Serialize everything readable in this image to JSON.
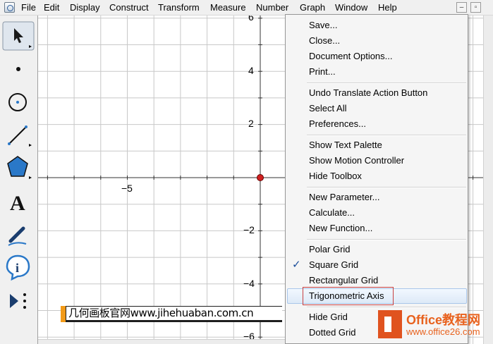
{
  "menubar": {
    "items": [
      "File",
      "Edit",
      "Display",
      "Construct",
      "Transform",
      "Measure",
      "Number",
      "Graph",
      "Window",
      "Help"
    ],
    "minimize": "–",
    "restore": "▫"
  },
  "toolbox": {
    "tools": [
      "arrow-tool",
      "point-tool",
      "compass-tool",
      "straightedge-tool",
      "polygon-tool",
      "text-tool",
      "marker-tool",
      "information-tool",
      "custom-tool"
    ]
  },
  "graph": {
    "x_labels": [
      "−5"
    ],
    "y_labels": [
      "6",
      "4",
      "2",
      "−2",
      "−4",
      "−6"
    ],
    "origin_point_color": "#d02020",
    "grid": true
  },
  "watermark": {
    "text": "几何画板官网www.jihehuaban.com.cn"
  },
  "dropdown": {
    "items": [
      "Save...",
      "Close...",
      "Document Options...",
      "Print...",
      "Undo Translate Action Button",
      "Select All",
      "Preferences...",
      "Show Text Palette",
      "Show Motion Controller",
      "Hide Toolbox",
      "New Parameter...",
      "Calculate...",
      "New Function...",
      "Polar Grid",
      "Square Grid",
      "Rectangular Grid",
      "Trigonometric Axis",
      "Hide Grid",
      "Dotted Grid"
    ],
    "checked_item": "Square Grid",
    "highlighted_item": "Trigonometric Axis",
    "checkmark": "✓"
  },
  "office_logo": {
    "name": "Office教程网",
    "url": "www.office26.com"
  },
  "colors": {
    "accent_orange": "#e8621e",
    "highlight_border": "#c84040",
    "toolbox_blue": "#2a78c8"
  }
}
